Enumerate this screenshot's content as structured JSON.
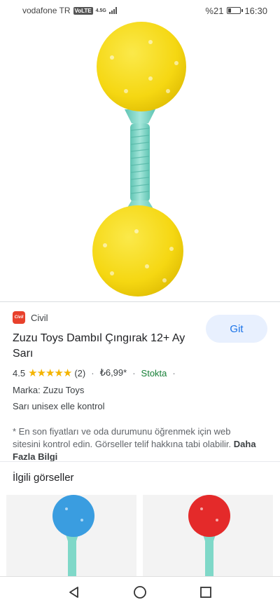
{
  "status_bar": {
    "carrier": "vodafone TR",
    "volte": "VoLTE",
    "network": "4.5G",
    "battery": "%21",
    "battery_fraction": 0.21,
    "time": "16:30"
  },
  "product": {
    "merchant": "Civil",
    "merchant_logo_text": "Civil",
    "title": "Zuzu Toys Dambıl Çıngırak 12+ Ay Sarı",
    "rating": "4.5",
    "stars": "★★★★★",
    "review_count": "(2)",
    "price": "₺6,99*",
    "availability": "Stokta",
    "brand": "Marka: Zuzu Toys",
    "description": "Sarı unisex elle kontrol",
    "go_button": "Git",
    "note": "* En son fiyatları ve oda durumunu öğrenmek için web sitesini kontrol edin. Görseller telif hakkına tabi olabilir.",
    "more_info_link": "Daha Fazla Bilgi"
  },
  "related": {
    "title": "İlgili görseller"
  },
  "colors": {
    "accent": "#1a73e8",
    "rattle_yellow": "#f5d712",
    "handle_mint": "#7fd8c8",
    "ball_blue": "#3a9de0",
    "ball_red": "#e42a2a",
    "stock_green": "#188038"
  },
  "icons": {
    "nav_back": "back-triangle-icon",
    "nav_home": "home-circle-icon",
    "nav_recents": "recents-square-icon"
  }
}
